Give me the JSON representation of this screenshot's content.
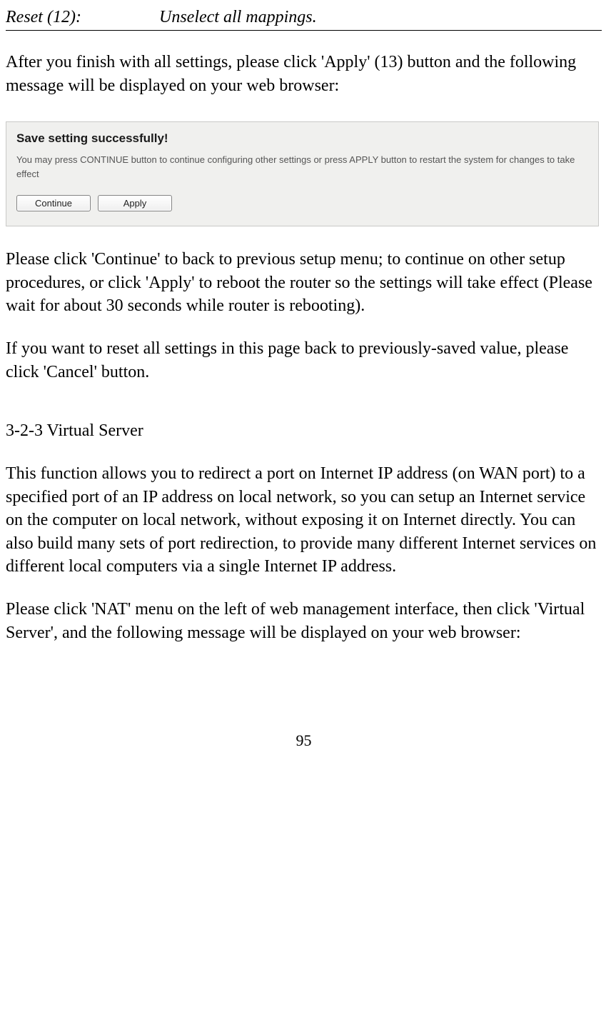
{
  "table": {
    "left": "Reset (12):",
    "right": "Unselect all mappings."
  },
  "para1": "After you finish with all settings, please click 'Apply' (13) button and the following message will be displayed on your web browser:",
  "dialog": {
    "title": "Save setting successfully!",
    "desc": "You may press CONTINUE button to continue configuring other settings or press APPLY button to restart the system for changes to take effect",
    "continue_label": "Continue",
    "apply_label": "Apply"
  },
  "para2": "Please click 'Continue' to back to previous setup menu; to continue on other setup procedures, or click 'Apply' to reboot the router so the settings will take effect (Please wait for about 30 seconds while router is rebooting).",
  "para3": "If you want to reset all settings in this page back to previously-saved value, please click 'Cancel' button.",
  "section_heading": "3-2-3 Virtual Server",
  "para4": "This function allows you to redirect a port on Internet IP address (on WAN port) to a specified port of an IP address on local network, so you can setup an Internet service on the computer on local network, without exposing it on Internet directly. You can also build many sets of port redirection, to provide many different Internet services on different local computers via a single Internet IP address.",
  "para5": "Please click 'NAT' menu on the left of web management interface, then click 'Virtual Server', and the following message will be displayed on your web browser:",
  "page_number": "95"
}
